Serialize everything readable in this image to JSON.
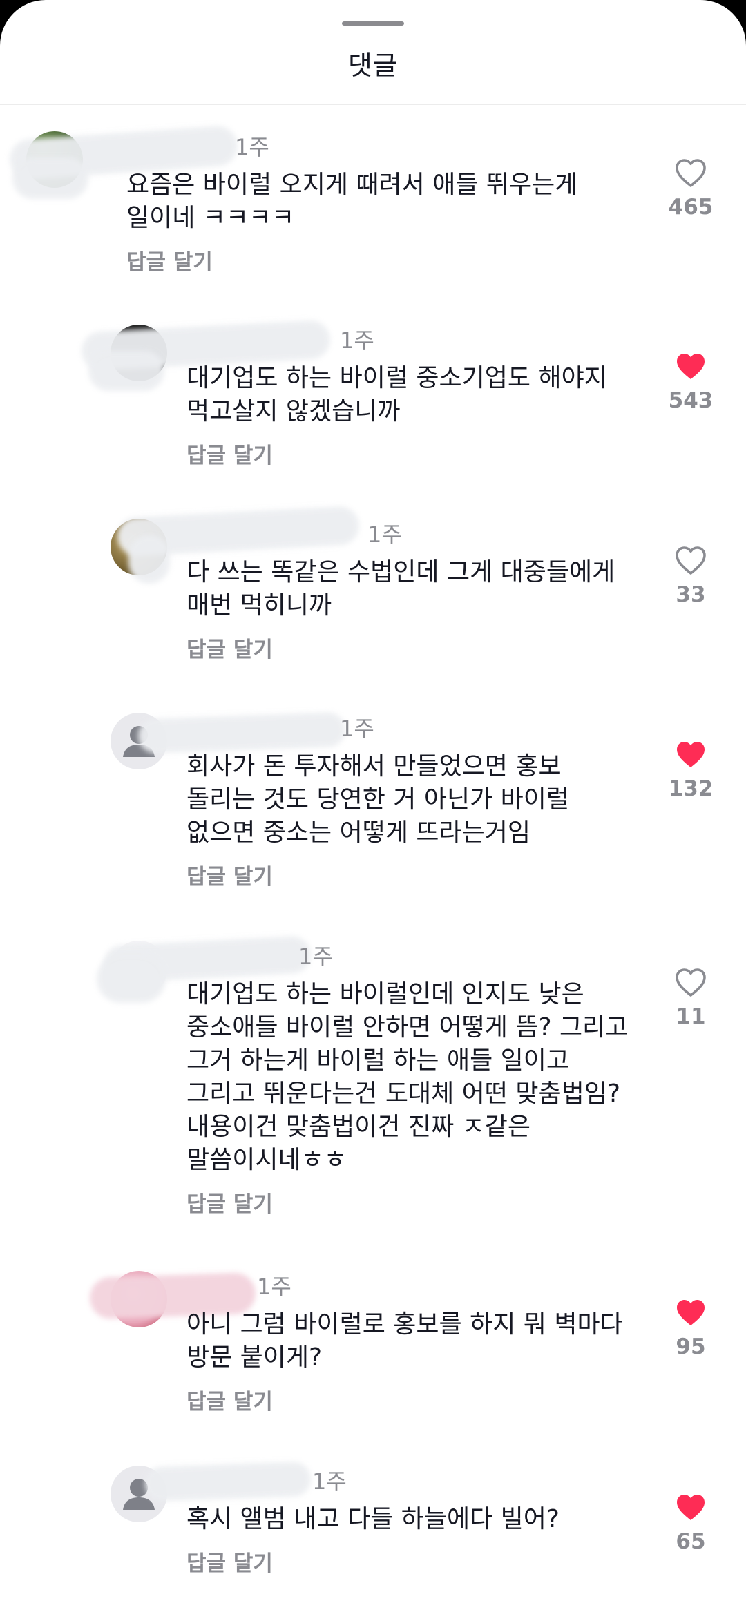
{
  "sheet": {
    "title": "댓글"
  },
  "comments": [
    {
      "time": "1주",
      "text": "요즘은 바이럴 오지게 때려서 애들 뛰우는게\n일이네 ㅋㅋㅋㅋ",
      "reply_label": "답글 달기",
      "likes": "465",
      "liked": false
    },
    {
      "time": "1주",
      "text": "대기업도 하는 바이럴 중소기업도 해야지\n먹고살지 않겠습니까",
      "reply_label": "답글 달기",
      "likes": "543",
      "liked": true
    },
    {
      "time": "1주",
      "text": "다 쓰는 똑같은 수법인데 그게 대중들에게\n매번 먹히니까",
      "reply_label": "답글 달기",
      "likes": "33",
      "liked": false
    },
    {
      "time": "1주",
      "text": "회사가 돈 투자해서 만들었으면 홍보\n돌리는 것도 당연한 거 아닌가 바이럴\n없으면 중소는 어떻게 뜨라는거임",
      "reply_label": "답글 달기",
      "likes": "132",
      "liked": true
    },
    {
      "time": "1주",
      "text": "대기업도 하는 바이럴인데 인지도 낮은\n중소애들 바이럴 안하면 어떻게 뜸? 그리고\n그거 하는게 바이럴 하는 애들 일이고\n그리고 뛰운다는건 도대체 어떤 맞춤법임?\n내용이건 맞춤법이건 진짜 ㅈ같은\n말씀이시네ㅎㅎ",
      "reply_label": "답글 달기",
      "likes": "11",
      "liked": false
    },
    {
      "time": "1주",
      "text": "아니 그럼 바이럴로 홍보를 하지 뭐 벽마다\n방문 붙이게?",
      "reply_label": "답글 달기",
      "likes": "95",
      "liked": true
    },
    {
      "time": "1주",
      "text": "혹시 앨범 내고 다들 하늘에다 빌어?",
      "reply_label": "답글 달기",
      "likes": "65",
      "liked": true
    }
  ],
  "icons": {
    "like": "heart-outline-icon",
    "liked": "heart-filled-icon",
    "default_avatar": "person-silhouette-icon"
  },
  "colors": {
    "liked_heart": "#fe2c55",
    "muted_text": "#8a8b91",
    "primary_text": "#161823"
  }
}
